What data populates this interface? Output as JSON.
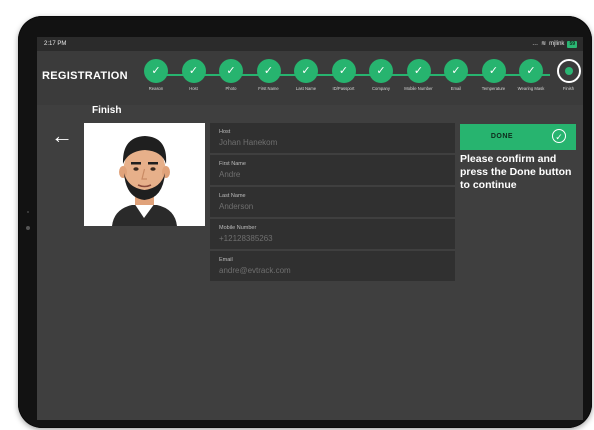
{
  "status": {
    "time": "2:17 PM",
    "signal": "…",
    "wifi_label": "mjlink",
    "battery_label": "59"
  },
  "header": {
    "title": "REGISTRATION"
  },
  "steps": [
    {
      "label": "Reason",
      "state": "done"
    },
    {
      "label": "Host",
      "state": "done"
    },
    {
      "label": "Photo",
      "state": "done"
    },
    {
      "label": "First Name",
      "state": "done"
    },
    {
      "label": "Last Name",
      "state": "done"
    },
    {
      "label": "ID/Passport",
      "state": "done"
    },
    {
      "label": "Company",
      "state": "done"
    },
    {
      "label": "Mobile Number",
      "state": "done"
    },
    {
      "label": "Email",
      "state": "done"
    },
    {
      "label": "Temperature",
      "state": "done"
    },
    {
      "label": "Wearing Mask",
      "state": "done"
    },
    {
      "label": "Finish",
      "state": "current"
    }
  ],
  "page": {
    "title": "Finish",
    "back_icon": "arrow-left-icon"
  },
  "fields": [
    {
      "label": "Host",
      "value": "Johan Hanekom"
    },
    {
      "label": "First Name",
      "value": "Andre"
    },
    {
      "label": "Last Name",
      "value": "Anderson"
    },
    {
      "label": "Mobile Number",
      "value": "+12128385263"
    },
    {
      "label": "Email",
      "value": "andre@evtrack.com"
    }
  ],
  "done": {
    "label": "DONE",
    "icon": "check-circle-icon",
    "instruction": "Please confirm and press the Done button to continue"
  },
  "colors": {
    "accent": "#27b46f",
    "screen_bg": "#3f3f3f",
    "field_bg": "#303030"
  }
}
